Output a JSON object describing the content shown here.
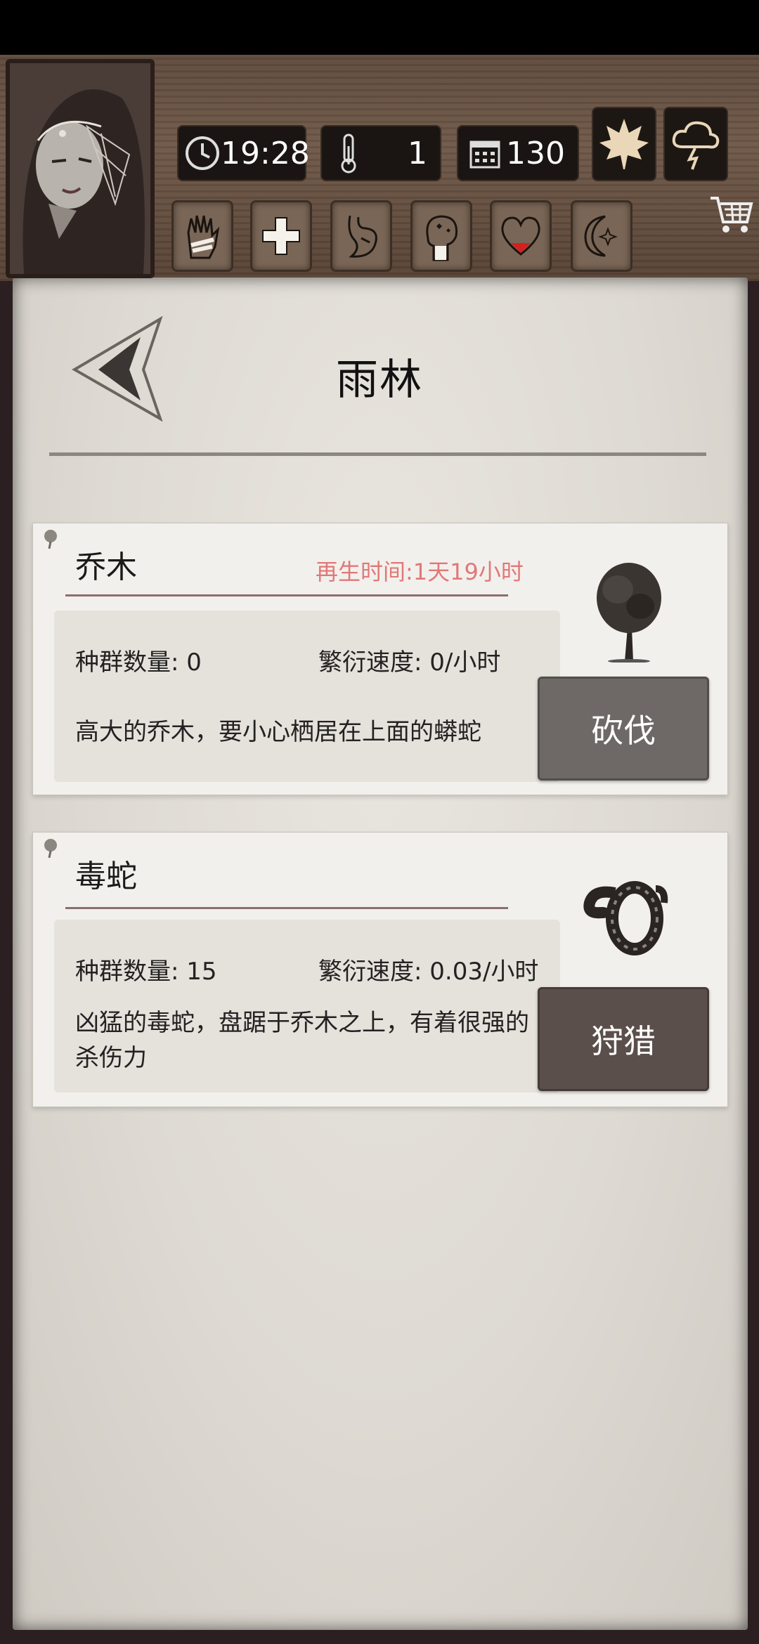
{
  "hud": {
    "time": "19:28",
    "temperature": "1",
    "days": "130",
    "icons": {
      "portrait": "hooded-woman-portrait",
      "clock": "clock-icon",
      "thermometer": "thermometer-icon",
      "calendar": "calendar-icon",
      "season": "maple-leaf-icon",
      "weather": "storm-cloud-icon",
      "shop": "shopping-cart-icon"
    },
    "abilities": [
      "hand-icon",
      "health-cross-icon",
      "stomach-icon",
      "mind-icon",
      "heart-icon",
      "moon-icon"
    ]
  },
  "page": {
    "title": "雨林"
  },
  "cards": [
    {
      "name": "乔木",
      "regen": "再生时间:1天19小时",
      "population": "种群数量: 0",
      "growth": "繁衍速度: 0/小时",
      "description": "高大的乔木，要小心栖居在上面的蟒蛇",
      "action": "砍伐",
      "action_color": "#6e6966",
      "art": "tree-icon"
    },
    {
      "name": "毒蛇",
      "population": "种群数量: 15",
      "growth": "繁衍速度: 0.03/小时",
      "description": "凶猛的毒蛇，盘踞于乔木之上，有着很强的杀伤力",
      "action": "狩猎",
      "action_color": "#5b4f4b",
      "art": "snake-icon"
    }
  ]
}
